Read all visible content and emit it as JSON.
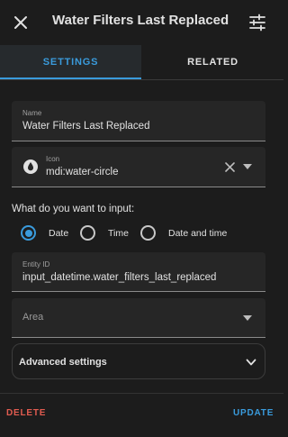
{
  "header": {
    "title": "Water Filters Last Replaced",
    "close_icon": "close-icon",
    "tune_icon": "tune-sliders-icon"
  },
  "tabs": [
    {
      "label": "SETTINGS",
      "active": true
    },
    {
      "label": "RELATED",
      "active": false
    }
  ],
  "form": {
    "name": {
      "label": "Name",
      "value": "Water Filters Last Replaced"
    },
    "icon": {
      "label": "Icon",
      "value": "mdi:water-circle",
      "icon_name": "water-circle-icon"
    },
    "input_question": "What do you want to input:",
    "input_options": [
      {
        "label": "Date",
        "selected": true
      },
      {
        "label": "Time",
        "selected": false
      },
      {
        "label": "Date and time",
        "selected": false
      }
    ],
    "entity_id": {
      "label": "Entity ID",
      "value": "input_datetime.water_filters_last_replaced"
    },
    "area": {
      "placeholder": "Area"
    },
    "advanced_label": "Advanced settings"
  },
  "footer": {
    "delete_label": "DELETE",
    "update_label": "UPDATE"
  },
  "colors": {
    "accent": "#3a9bdc",
    "danger": "#e25c50",
    "background": "#1c1c1c"
  }
}
